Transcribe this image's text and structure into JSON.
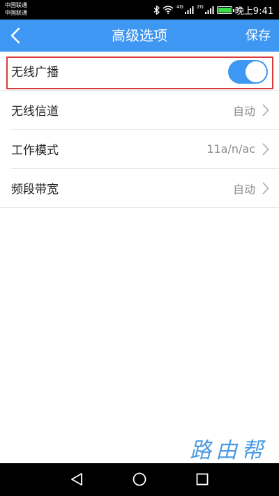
{
  "status_bar": {
    "carrier_1": "中国联通",
    "carrier_2": "中国联通",
    "net_1": "4G",
    "net_2": "2G",
    "time_text": "晚上9:41",
    "battery_color": "#3ddc4a"
  },
  "header": {
    "title": "高级选项",
    "save_label": "保存",
    "background_color": "#3e97f2"
  },
  "settings": {
    "wireless_broadcast": {
      "label": "无线广播",
      "enabled": true
    },
    "wireless_channel": {
      "label": "无线信道",
      "value": "自动"
    },
    "work_mode": {
      "label": "工作模式",
      "value": "11a/n/ac"
    },
    "bandwidth": {
      "label": "频段带宽",
      "value": "自动"
    }
  },
  "highlight_color": "#d83a3a",
  "watermark": "路由帮",
  "system_nav": {
    "back_icon": "triangle-back-icon",
    "home_icon": "circle-home-icon",
    "recent_icon": "square-recent-icon"
  }
}
